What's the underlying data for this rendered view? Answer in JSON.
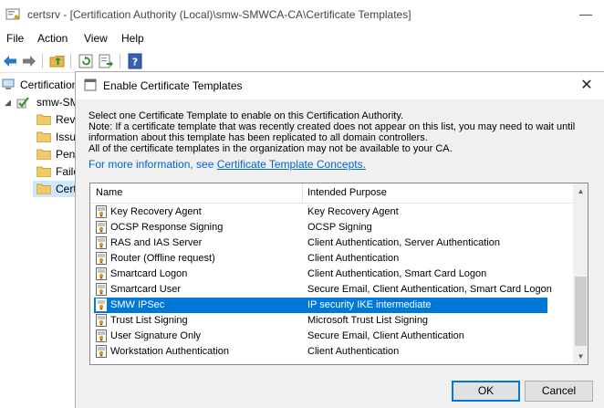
{
  "window": {
    "title": "certsrv - [Certification Authority (Local)\\smw-SMWCA-CA\\Certificate Templates]",
    "minimize_glyph": "—"
  },
  "menu": [
    "File",
    "Action",
    "View",
    "Help"
  ],
  "toolbar_icons": [
    "back-arrow-icon",
    "forward-arrow-icon",
    "up-folder-icon",
    "refresh-icon",
    "export-list-icon",
    "help-icon"
  ],
  "tree": {
    "root": "Certification Authority (Local)",
    "ca": "smw-SMWCA-CA",
    "items": [
      "Revoked Certificates",
      "Issued Certificates",
      "Pending Requests",
      "Failed Requests",
      "Certificate Templates"
    ]
  },
  "dialog": {
    "title": "Enable Certificate Templates",
    "close_glyph": "✕",
    "description": [
      "Select one Certificate Template to enable on this Certification Authority.",
      "Note: If a certificate template that was recently created does not appear on this list, you may need to wait until",
      "information about this template has been replicated to all domain controllers.",
      "All of the certificate templates in the organization may not be available to your CA."
    ],
    "more_info_prefix": "For more information, see ",
    "more_info_link": "Certificate Template Concepts.",
    "columns": {
      "name": "Name",
      "purpose": "Intended Purpose"
    },
    "rows": [
      {
        "name": "Key Recovery Agent",
        "purpose": "Key Recovery Agent"
      },
      {
        "name": "OCSP Response Signing",
        "purpose": "OCSP Signing"
      },
      {
        "name": "RAS and IAS Server",
        "purpose": "Client Authentication, Server Authentication"
      },
      {
        "name": "Router (Offline request)",
        "purpose": "Client Authentication"
      },
      {
        "name": "Smartcard Logon",
        "purpose": "Client Authentication, Smart Card Logon"
      },
      {
        "name": "Smartcard User",
        "purpose": "Secure Email, Client Authentication, Smart Card Logon"
      },
      {
        "name": "SMW IPSec",
        "purpose": "IP security IKE intermediate"
      },
      {
        "name": "Trust List Signing",
        "purpose": "Microsoft Trust List Signing"
      },
      {
        "name": "User Signature Only",
        "purpose": "Secure Email, Client Authentication"
      },
      {
        "name": "Workstation Authentication",
        "purpose": "Client Authentication"
      }
    ],
    "selected_row": "SMW IPSec",
    "ok_label": "OK",
    "cancel_label": "Cancel",
    "scroll_up_glyph": "▲",
    "scroll_down_glyph": "▼"
  },
  "colors": {
    "selection": "#0078d7",
    "link": "#0066cc",
    "dialog_bg": "#f0f0f0"
  }
}
